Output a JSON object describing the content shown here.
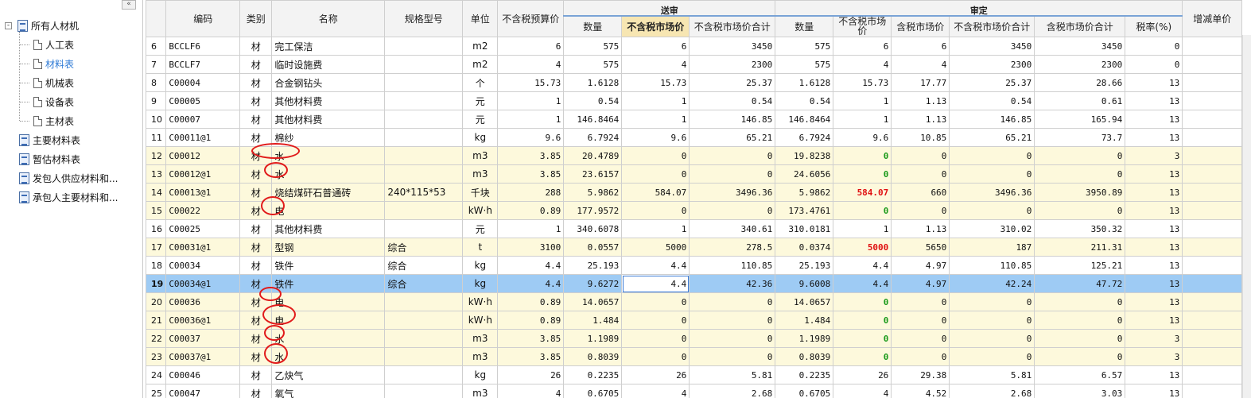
{
  "tree": {
    "collapse_glyph": "«",
    "items": [
      {
        "label": "所有人材机",
        "expander": "-"
      },
      {
        "label": "人工表"
      },
      {
        "label": "材料表"
      },
      {
        "label": "机械表"
      },
      {
        "label": "设备表"
      },
      {
        "label": "主材表"
      },
      {
        "label": "主要材料表"
      },
      {
        "label": "暂估材料表"
      },
      {
        "label": "发包人供应材料和..."
      },
      {
        "label": "承包人主要材料和..."
      }
    ]
  },
  "grid": {
    "groups": [
      "送审",
      "审定"
    ],
    "headers": {
      "code": "编码",
      "type": "类别",
      "name": "名称",
      "spec": "规格型号",
      "unit": "单位",
      "budget": "不含税预算价",
      "qty1": "数量",
      "market1": "不含税市场价",
      "market_total1": "不含税市场价合计",
      "qty2": "数量",
      "market2": "不含税市场价",
      "tax_market2": "含税市场价",
      "market_total2": "不含税市场价合计",
      "tax_total2": "含税市场价合计",
      "tax_rate": "税率(%)",
      "delta": "增减单价"
    },
    "rows": [
      {
        "n": "6",
        "code": "BCCLF6",
        "type": "材",
        "name": "完工保洁",
        "spec": "",
        "unit": "m2",
        "budget": "6",
        "qty1": "575",
        "market1": "6",
        "mt1": "3450",
        "qty2": "575",
        "market2": "6",
        "tax_market2": "6",
        "mt2": "3450",
        "tt2": "3450",
        "rate": "0"
      },
      {
        "n": "7",
        "code": "BCCLF7",
        "type": "材",
        "name": "临时设施费",
        "spec": "",
        "unit": "m2",
        "budget": "4",
        "qty1": "575",
        "market1": "4",
        "mt1": "2300",
        "qty2": "575",
        "market2": "4",
        "tax_market2": "4",
        "mt2": "2300",
        "tt2": "2300",
        "rate": "0"
      },
      {
        "n": "8",
        "code": "C00004",
        "type": "材",
        "name": "合金钢钻头",
        "spec": "",
        "unit": "个",
        "budget": "15.73",
        "qty1": "1.6128",
        "market1": "15.73",
        "mt1": "25.37",
        "qty2": "1.6128",
        "market2": "15.73",
        "tax_market2": "17.77",
        "mt2": "25.37",
        "tt2": "28.66",
        "rate": "13"
      },
      {
        "n": "9",
        "code": "C00005",
        "type": "材",
        "name": "其他材料费",
        "spec": "",
        "unit": "元",
        "budget": "1",
        "qty1": "0.54",
        "market1": "1",
        "mt1": "0.54",
        "qty2": "0.54",
        "market2": "1",
        "tax_market2": "1.13",
        "mt2": "0.54",
        "tt2": "0.61",
        "rate": "13"
      },
      {
        "n": "10",
        "code": "C00007",
        "type": "材",
        "name": "其他材料费",
        "spec": "",
        "unit": "元",
        "budget": "1",
        "qty1": "146.8464",
        "market1": "1",
        "mt1": "146.85",
        "qty2": "146.8464",
        "market2": "1",
        "tax_market2": "1.13",
        "mt2": "146.85",
        "tt2": "165.94",
        "rate": "13"
      },
      {
        "n": "11",
        "code": "C00011@1",
        "type": "材",
        "name": "棉纱",
        "spec": "",
        "unit": "kg",
        "budget": "9.6",
        "qty1": "6.7924",
        "market1": "9.6",
        "mt1": "65.21",
        "qty2": "6.7924",
        "market2": "9.6",
        "tax_market2": "10.85",
        "mt2": "65.21",
        "tt2": "73.7",
        "rate": "13"
      },
      {
        "n": "12",
        "code": "C00012",
        "type": "材",
        "name": "水",
        "spec": "",
        "unit": "m3",
        "budget": "3.85",
        "qty1": "20.4789",
        "market1": "0",
        "mt1": "0",
        "qty2": "19.8238",
        "market2": "0",
        "m2style": "green",
        "tax_market2": "0",
        "mt2": "0",
        "tt2": "0",
        "rate": "3",
        "yellow": true
      },
      {
        "n": "13",
        "code": "C00012@1",
        "type": "材",
        "name": "水",
        "spec": "",
        "unit": "m3",
        "budget": "3.85",
        "qty1": "23.6157",
        "market1": "0",
        "mt1": "0",
        "qty2": "24.6056",
        "market2": "0",
        "m2style": "green",
        "tax_market2": "0",
        "mt2": "0",
        "tt2": "0",
        "rate": "13",
        "yellow": true
      },
      {
        "n": "14",
        "code": "C00013@1",
        "type": "材",
        "name": "烧结煤矸石普通砖",
        "spec": "240*115*53",
        "unit": "千块",
        "budget": "288",
        "qty1": "5.9862",
        "market1": "584.07",
        "mt1": "3496.36",
        "qty2": "5.9862",
        "market2": "584.07",
        "m2style": "red",
        "tax_market2": "660",
        "mt2": "3496.36",
        "tt2": "3950.89",
        "rate": "13",
        "yellow": true
      },
      {
        "n": "15",
        "code": "C00022",
        "type": "材",
        "name": "电",
        "spec": "",
        "unit": "kW·h",
        "budget": "0.89",
        "qty1": "177.9572",
        "market1": "0",
        "mt1": "0",
        "qty2": "173.4761",
        "market2": "0",
        "m2style": "green",
        "tax_market2": "0",
        "mt2": "0",
        "tt2": "0",
        "rate": "13",
        "yellow": true
      },
      {
        "n": "16",
        "code": "C00025",
        "type": "材",
        "name": "其他材料费",
        "spec": "",
        "unit": "元",
        "budget": "1",
        "qty1": "340.6078",
        "market1": "1",
        "mt1": "340.61",
        "qty2": "310.0181",
        "market2": "1",
        "tax_market2": "1.13",
        "mt2": "310.02",
        "tt2": "350.32",
        "rate": "13"
      },
      {
        "n": "17",
        "code": "C00031@1",
        "type": "材",
        "name": "型钢",
        "spec": "综合",
        "unit": "t",
        "budget": "3100",
        "qty1": "0.0557",
        "market1": "5000",
        "mt1": "278.5",
        "qty2": "0.0374",
        "market2": "5000",
        "m2style": "red",
        "tax_market2": "5650",
        "mt2": "187",
        "tt2": "211.31",
        "rate": "13",
        "yellow": true
      },
      {
        "n": "18",
        "code": "C00034",
        "type": "材",
        "name": "铁件",
        "spec": "综合",
        "unit": "kg",
        "budget": "4.4",
        "qty1": "25.193",
        "market1": "4.4",
        "mt1": "110.85",
        "qty2": "25.193",
        "market2": "4.4",
        "tax_market2": "4.97",
        "mt2": "110.85",
        "tt2": "125.21",
        "rate": "13"
      },
      {
        "n": "19",
        "code": "C00034@1",
        "type": "材",
        "name": "铁件",
        "spec": "综合",
        "unit": "kg",
        "budget": "4.4",
        "qty1": "9.6272",
        "market1": "4.4",
        "mt1": "42.36",
        "qty2": "9.6008",
        "market2": "4.4",
        "tax_market2": "4.97",
        "mt2": "42.24",
        "tt2": "47.72",
        "rate": "13",
        "selected": true
      },
      {
        "n": "20",
        "code": "C00036",
        "type": "材",
        "name": "电",
        "spec": "",
        "unit": "kW·h",
        "budget": "0.89",
        "qty1": "14.0657",
        "market1": "0",
        "mt1": "0",
        "qty2": "14.0657",
        "market2": "0",
        "m2style": "green",
        "tax_market2": "0",
        "mt2": "0",
        "tt2": "0",
        "rate": "13",
        "yellow": true
      },
      {
        "n": "21",
        "code": "C00036@1",
        "type": "材",
        "name": "电",
        "spec": "",
        "unit": "kW·h",
        "budget": "0.89",
        "qty1": "1.484",
        "market1": "0",
        "mt1": "0",
        "qty2": "1.484",
        "market2": "0",
        "m2style": "green",
        "tax_market2": "0",
        "mt2": "0",
        "tt2": "0",
        "rate": "13",
        "yellow": true
      },
      {
        "n": "22",
        "code": "C00037",
        "type": "材",
        "name": "水",
        "spec": "",
        "unit": "m3",
        "budget": "3.85",
        "qty1": "1.1989",
        "market1": "0",
        "mt1": "0",
        "qty2": "1.1989",
        "market2": "0",
        "m2style": "green",
        "tax_market2": "0",
        "mt2": "0",
        "tt2": "0",
        "rate": "3",
        "yellow": true
      },
      {
        "n": "23",
        "code": "C00037@1",
        "type": "材",
        "name": "水",
        "spec": "",
        "unit": "m3",
        "budget": "3.85",
        "qty1": "0.8039",
        "market1": "0",
        "mt1": "0",
        "qty2": "0.8039",
        "market2": "0",
        "m2style": "green",
        "tax_market2": "0",
        "mt2": "0",
        "tt2": "0",
        "rate": "3",
        "yellow": true
      },
      {
        "n": "24",
        "code": "C00046",
        "type": "材",
        "name": "乙炔气",
        "spec": "",
        "unit": "kg",
        "budget": "26",
        "qty1": "0.2235",
        "market1": "26",
        "mt1": "5.81",
        "qty2": "0.2235",
        "market2": "26",
        "tax_market2": "29.38",
        "mt2": "5.81",
        "tt2": "6.57",
        "rate": "13"
      },
      {
        "n": "25",
        "code": "C00047",
        "type": "材",
        "name": "氧气",
        "spec": "",
        "unit": "m3",
        "budget": "4",
        "qty1": "0.6705",
        "market1": "4",
        "mt1": "2.68",
        "qty2": "0.6705",
        "market2": "4",
        "tax_market2": "4.52",
        "mt2": "2.68",
        "tt2": "3.03",
        "rate": "13"
      }
    ]
  }
}
